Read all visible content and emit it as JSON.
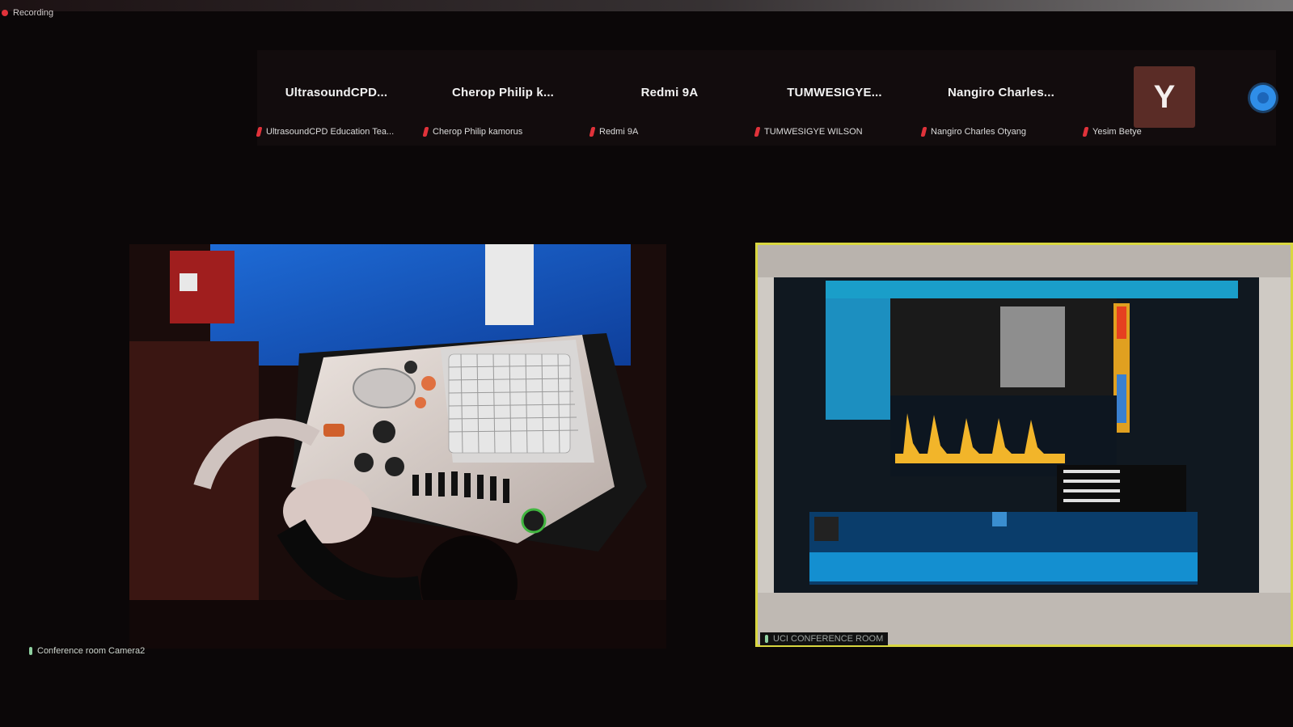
{
  "status": {
    "recording_label": "Recording"
  },
  "participants": [
    {
      "name": "UltrasoundCPD...",
      "label": "UltrasoundCPD Education Tea..."
    },
    {
      "name": "Cherop Philip k...",
      "label": "Cherop Philip kamorus"
    },
    {
      "name": "Redmi 9A",
      "label": "Redmi 9A"
    },
    {
      "name": "TUMWESIGYE...",
      "label": "TUMWESIGYE WILSON"
    },
    {
      "name": "Nangiro Charles...",
      "label": "Nangiro Charles Otyang"
    },
    {
      "initial": "Y",
      "label": "Yesim Betye"
    }
  ],
  "video_feeds": {
    "left": {
      "label": "Conference room Camera2"
    },
    "right": {
      "label": "UCI CONFERENCE ROOM"
    }
  },
  "colors": {
    "active_speaker_border": "#d8d640",
    "muted_mic": "#e0323a",
    "avatar_bg": "#5a2c26",
    "accent_button": "#2f8ee8"
  },
  "icons": [
    "record-dot-icon",
    "mic-muted-icon",
    "mic-icon",
    "options-circle-icon"
  ]
}
